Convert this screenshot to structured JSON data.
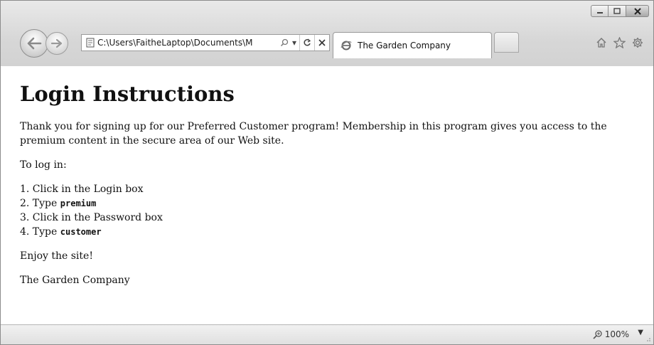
{
  "window": {
    "controls": {
      "minimize": "▭",
      "maximize": "□",
      "close": "✕"
    }
  },
  "nav": {
    "address_url": "C:\\Users\\FaitheLaptop\\Documents\\M",
    "search_icon": "search-icon",
    "dropdown_icon": "▾",
    "refresh_icon": "↻",
    "stop_icon": "✕"
  },
  "tab": {
    "title": "The Garden Company"
  },
  "tools": [
    "home-icon",
    "favorites-star-icon",
    "gear-icon"
  ],
  "content": {
    "heading": "Login Instructions",
    "intro": "Thank you for signing up for our Preferred Customer program! Membership in this program gives you access to the premium content in the secure area of our Web site.",
    "login_lead": "To log in:",
    "steps": [
      {
        "text": "1. Click in the Login box",
        "code": ""
      },
      {
        "text": "2. Type ",
        "code": "premium"
      },
      {
        "text": "3. Click in the Password box",
        "code": ""
      },
      {
        "text": "4. Type ",
        "code": "customer"
      }
    ],
    "enjoy": "Enjoy the site!",
    "signature": "The Garden Company"
  },
  "status": {
    "zoom": "100%",
    "zoom_dropdown": "▼"
  },
  "colors": {
    "chrome": "#d7d7d7",
    "text": "#111111",
    "status_bar": "#e9e9e9"
  }
}
